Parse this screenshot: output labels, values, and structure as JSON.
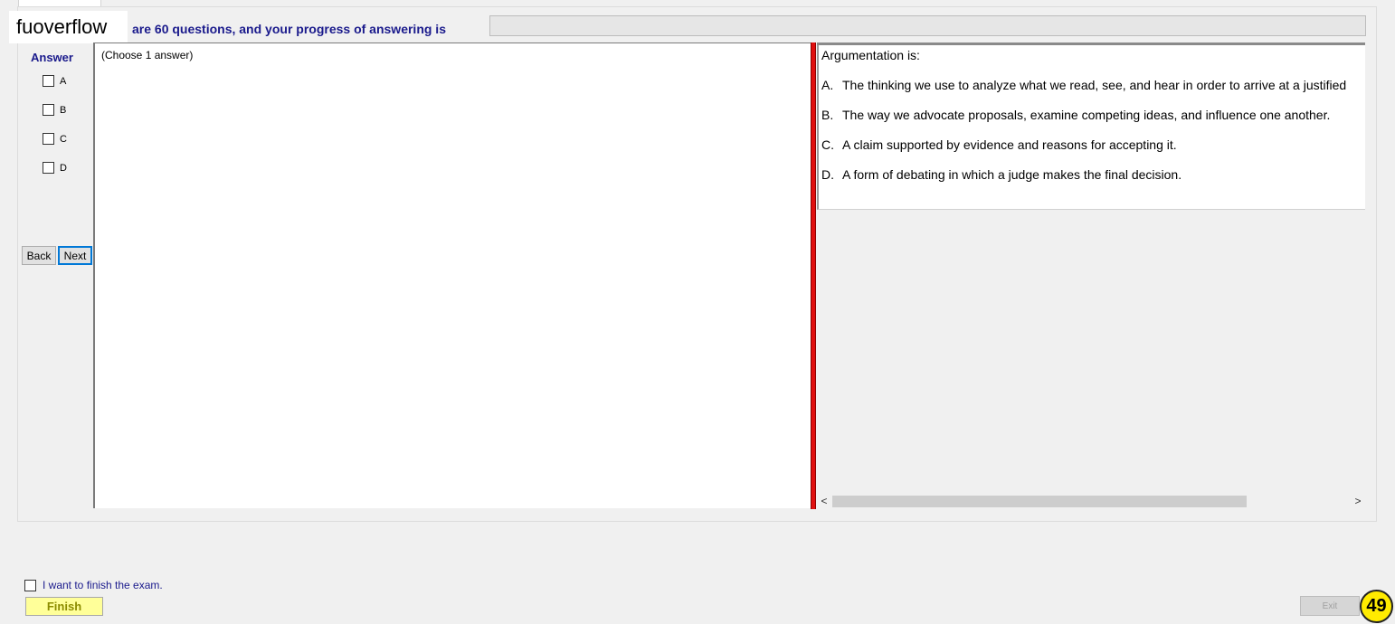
{
  "watermark": "fuoverflow",
  "header": {
    "progress_label": "are 60 questions, and your progress of answering is",
    "progress_value": 0
  },
  "answer_panel": {
    "title": "Answer",
    "options": [
      "A",
      "B",
      "C",
      "D"
    ],
    "back_label": "Back",
    "next_label": "Next"
  },
  "left_panel": {
    "instruction": "(Choose 1 answer)"
  },
  "question": {
    "stem": "Argumentation is:",
    "options": [
      {
        "letter": "A.",
        "text": "The thinking we use to analyze what we read, see, and hear in order to arrive at a justified"
      },
      {
        "letter": "B.",
        "text": "The way we advocate proposals, examine competing ideas, and influence one another."
      },
      {
        "letter": "C.",
        "text": "A claim supported by evidence and reasons for accepting it."
      },
      {
        "letter": "D.",
        "text": "A form of debating in which a judge makes the final decision."
      }
    ],
    "scroll_left": "<",
    "scroll_right": ">"
  },
  "footer": {
    "finish_checkbox_label": "I want to finish the exam.",
    "finish_label": "Finish",
    "exit_label": "Exit",
    "badge": "49"
  }
}
